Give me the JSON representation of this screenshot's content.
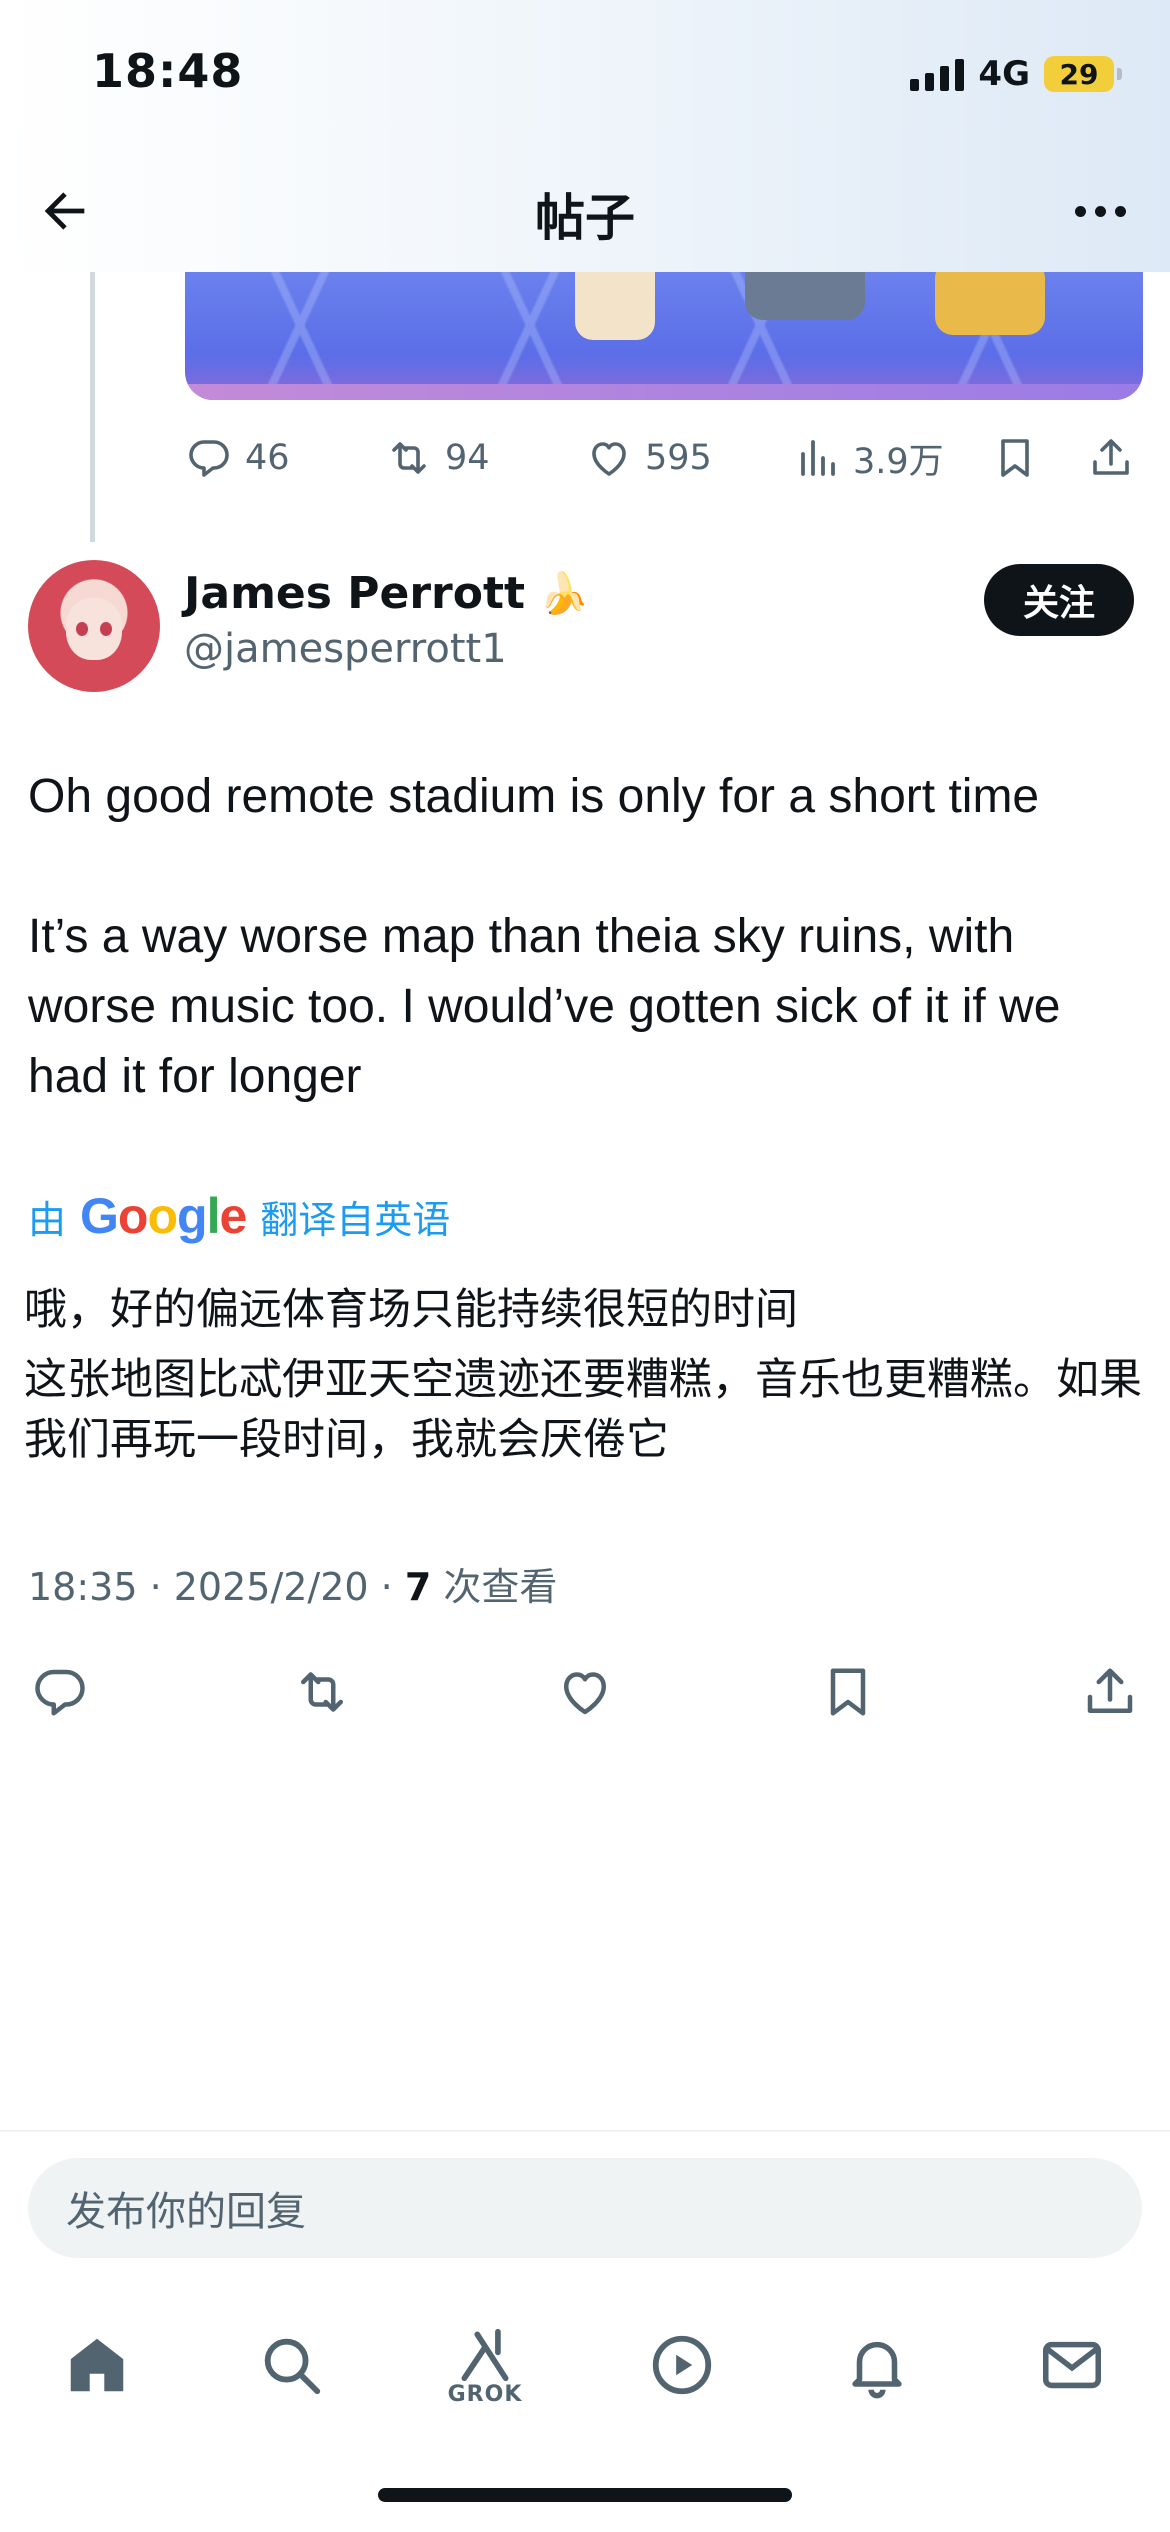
{
  "status_bar": {
    "time": "18:48",
    "network": "4G",
    "battery": "29"
  },
  "header": {
    "title": "帖子"
  },
  "parent_tweet": {
    "stats": {
      "replies": "46",
      "reposts": "94",
      "likes": "595",
      "views": "3.9万"
    }
  },
  "tweet": {
    "author_name": "James Perrott",
    "author_badge": "🍌",
    "handle": "@jamesperrott1",
    "follow_label": "关注",
    "paragraphs": [
      "Oh good remote stadium is only for a short time",
      "It’s a way worse map than theia sky ruins, with worse music too. I would’ve gotten sick of it if we had it for longer"
    ],
    "translate_prefix": "由",
    "translate_brand": "Google",
    "translate_suffix": "翻译自英语",
    "translated": [
      "哦，好的偏远体育场只能持续很短的时间",
      "这张地图比忒伊亚天空遗迹还要糟糕，音乐也更糟糕。如果我们再玩一段时间，我就会厌倦它"
    ],
    "timestamp": "18:35 · 2025/2/20 · ",
    "view_count": "7",
    "view_label": " 次查看"
  },
  "reply": {
    "placeholder": "发布你的回复"
  },
  "tabbar": {
    "grok_label": "GROK"
  },
  "colors": {
    "accent": "#1d9bf0",
    "text": "#0f1419",
    "secondary": "#536471",
    "follow_bg": "#0f1419"
  },
  "icons": [
    "back-arrow-icon",
    "more-icon",
    "reply-icon",
    "repost-icon",
    "like-icon",
    "views-icon",
    "bookmark-icon",
    "share-icon",
    "home-icon",
    "search-icon",
    "grok-icon",
    "video-icon",
    "notifications-icon",
    "messages-icon"
  ]
}
